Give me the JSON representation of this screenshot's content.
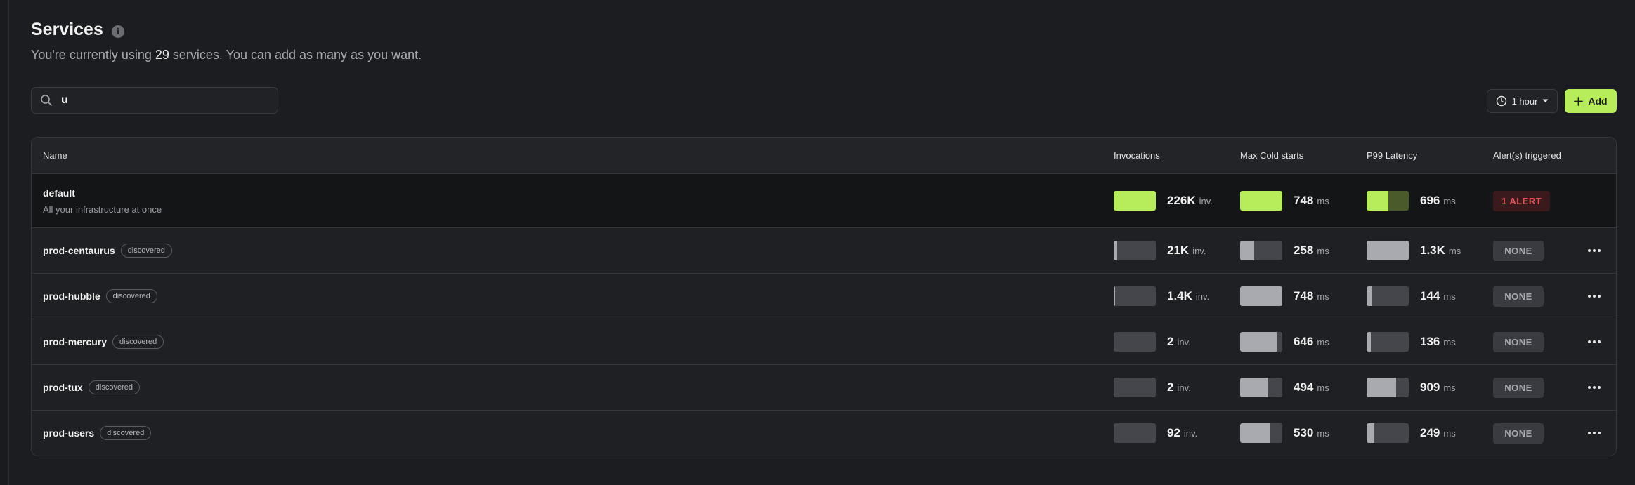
{
  "page": {
    "title": "Services",
    "subtitle_prefix": "You're currently using ",
    "service_count": "29",
    "subtitle_suffix": " services. You can add as many as you want."
  },
  "search": {
    "value": "u",
    "placeholder": ""
  },
  "toolbar": {
    "time_range": "1 hour",
    "add_label": "Add"
  },
  "colors": {
    "accent": "#b7ec5a",
    "alert_red": "#e0555b",
    "background": "#1c1d20"
  },
  "table": {
    "headers": {
      "name": "Name",
      "invocations": "Invocations",
      "cold_starts": "Max Cold starts",
      "p99": "P99 Latency",
      "alerts": "Alert(s) triggered"
    },
    "rows": [
      {
        "name": "default",
        "description": "All your infrastructure at once",
        "badge": "",
        "invocations": "226K",
        "inv_unit": "inv.",
        "inv_level": 1.0,
        "cold": "748",
        "cold_unit": "ms",
        "cold_level": 1.0,
        "p99": "696",
        "p99_unit": "ms",
        "p99_level": 0.52,
        "alert": "1 ALERT",
        "alert_type": "red"
      },
      {
        "name": "prod-centaurus",
        "description": "",
        "badge": "discovered",
        "invocations": "21K",
        "inv_unit": "inv.",
        "inv_level": 0.09,
        "cold": "258",
        "cold_unit": "ms",
        "cold_level": 0.34,
        "p99": "1.3K",
        "p99_unit": "ms",
        "p99_level": 1.0,
        "alert": "NONE",
        "alert_type": "none"
      },
      {
        "name": "prod-hubble",
        "description": "",
        "badge": "discovered",
        "invocations": "1.4K",
        "inv_unit": "inv.",
        "inv_level": 0.01,
        "cold": "748",
        "cold_unit": "ms",
        "cold_level": 1.0,
        "p99": "144",
        "p99_unit": "ms",
        "p99_level": 0.11,
        "alert": "NONE",
        "alert_type": "none"
      },
      {
        "name": "prod-mercury",
        "description": "",
        "badge": "discovered",
        "invocations": "2",
        "inv_unit": "inv.",
        "inv_level": 0.0,
        "cold": "646",
        "cold_unit": "ms",
        "cold_level": 0.86,
        "p99": "136",
        "p99_unit": "ms",
        "p99_level": 0.1,
        "alert": "NONE",
        "alert_type": "none"
      },
      {
        "name": "prod-tux",
        "description": "",
        "badge": "discovered",
        "invocations": "2",
        "inv_unit": "inv.",
        "inv_level": 0.0,
        "cold": "494",
        "cold_unit": "ms",
        "cold_level": 0.66,
        "p99": "909",
        "p99_unit": "ms",
        "p99_level": 0.7,
        "alert": "NONE",
        "alert_type": "none"
      },
      {
        "name": "prod-users",
        "description": "",
        "badge": "discovered",
        "invocations": "92",
        "inv_unit": "inv.",
        "inv_level": 0.0,
        "cold": "530",
        "cold_unit": "ms",
        "cold_level": 0.71,
        "p99": "249",
        "p99_unit": "ms",
        "p99_level": 0.19,
        "alert": "NONE",
        "alert_type": "none"
      }
    ]
  }
}
